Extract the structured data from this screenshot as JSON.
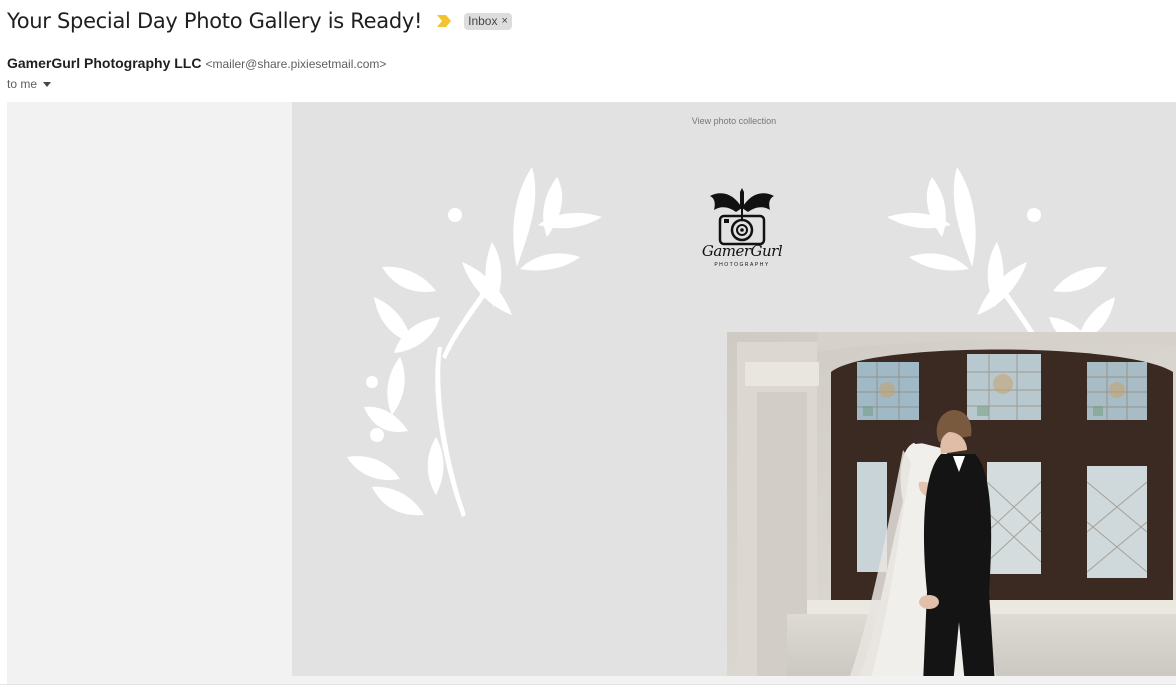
{
  "email": {
    "subject": "Your Special Day Photo Gallery is Ready!",
    "label": "Inbox",
    "label_remove": "×",
    "sender_name": "GamerGurl Photography LLC",
    "sender_email": "<mailer@share.pixiesetmail.com>",
    "recipient": "to me"
  },
  "body": {
    "view_link": "View photo collection",
    "logo_text": "GamerGurl",
    "logo_subtext": "PHOTOGRAPHY"
  },
  "icons": {
    "important": "important-marker-icon",
    "caret": "chevron-down-icon",
    "logo": "dragon-camera-logo"
  },
  "colors": {
    "important_marker": "#f4c430",
    "panel_bg": "#e2e2e2",
    "outer_bg": "#f2f2f2",
    "chip_bg": "#dddddd"
  }
}
